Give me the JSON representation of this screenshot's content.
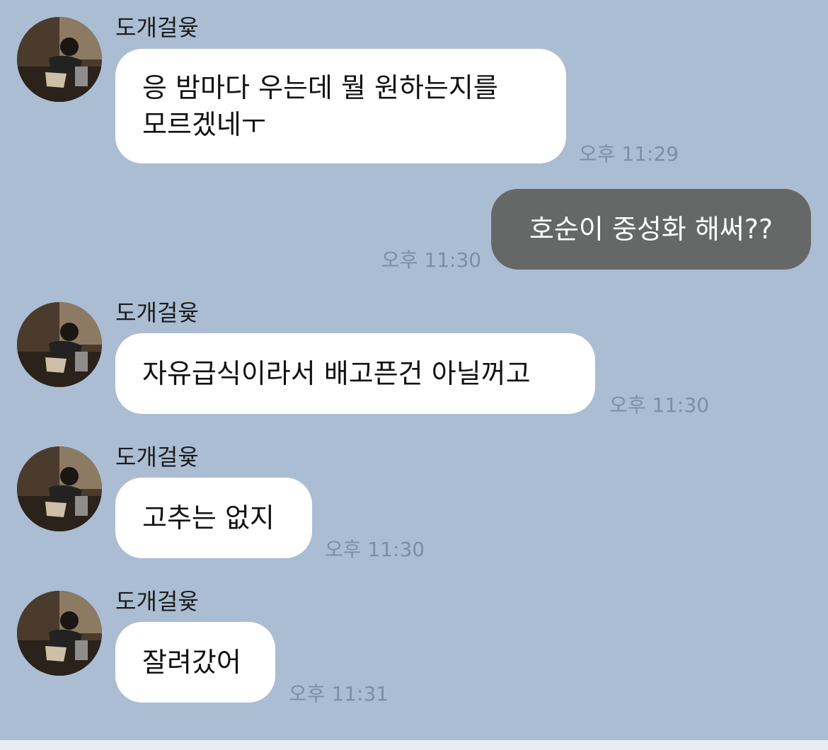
{
  "messages": [
    {
      "sender": "도개걸윷",
      "text": "응 밤마다 우는데 뭘 원하는지를\n모르겠네ㅜ",
      "time": "오후 11:29"
    },
    {
      "sender": "",
      "text": "호순이 중성화 해써??",
      "time": "오후 11:30"
    },
    {
      "sender": "도개걸윷",
      "text": "자유급식이라서 배고픈건 아닐꺼고",
      "time": "오후 11:30"
    },
    {
      "sender": "도개걸윷",
      "text": "고추는 없지",
      "time": "오후 11:30"
    },
    {
      "sender": "도개걸윷",
      "text": "잘려갔어",
      "time": "오후 11:31"
    }
  ],
  "colors": {
    "background": "#abbdd3",
    "incoming_bubble": "#ffffff",
    "outgoing_bubble": "#666767",
    "timestamp": "#7d8ea4"
  }
}
